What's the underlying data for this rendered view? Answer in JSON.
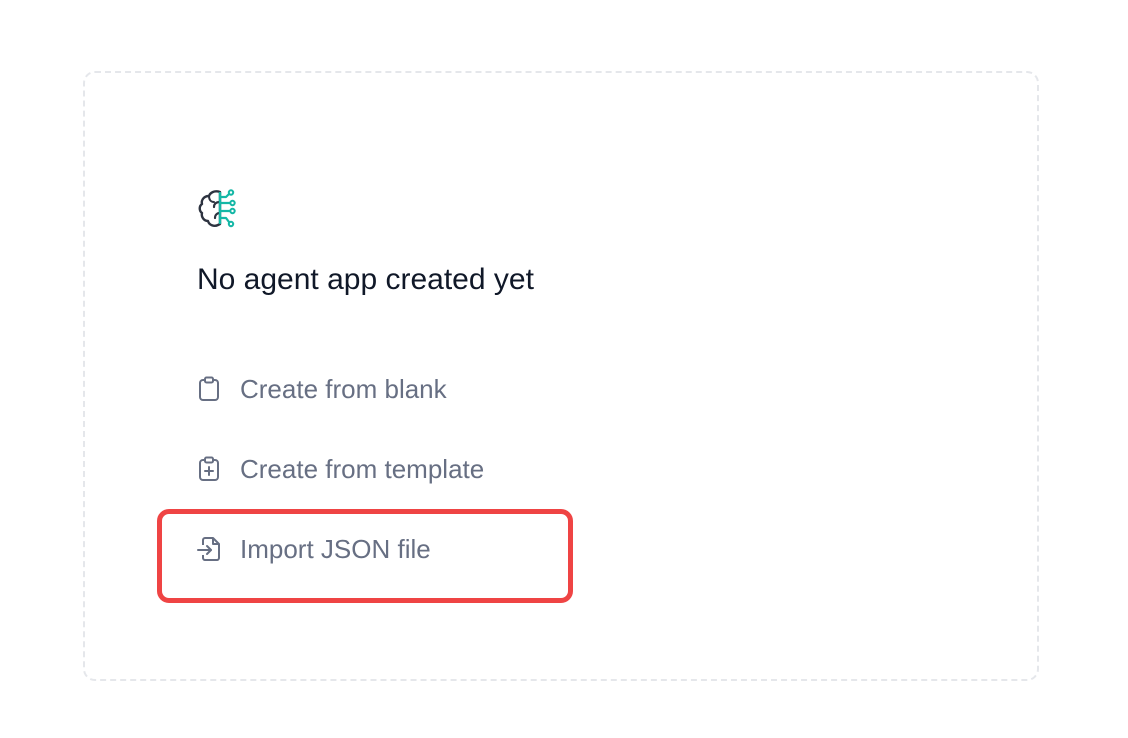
{
  "empty_state": {
    "title": "No agent app created yet",
    "icon": "brain-circuit-icon"
  },
  "actions": [
    {
      "label": "Create from blank",
      "icon": "clipboard-icon"
    },
    {
      "label": "Create from template",
      "icon": "clipboard-plus-icon"
    },
    {
      "label": "Import JSON file",
      "icon": "file-import-icon"
    }
  ],
  "colors": {
    "title_text": "#101828",
    "action_text": "#676f83",
    "accent_teal": "#15b7a6",
    "highlight": "#ef4444",
    "card_border": "#e5e7eb"
  }
}
